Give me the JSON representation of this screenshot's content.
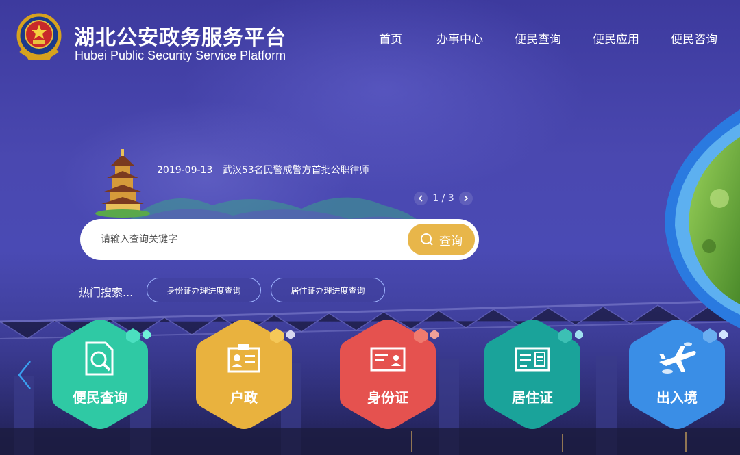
{
  "header": {
    "title": "湖北公安政务服务平台",
    "subtitle": "Hubei Public Security Service Platform"
  },
  "nav": [
    "首页",
    "办事中心",
    "便民查询",
    "便民应用",
    "便民咨询"
  ],
  "news": {
    "date": "2019-09-13",
    "headline": "武汉53名民警成警方首批公职律师",
    "page": "1 / 3"
  },
  "search": {
    "placeholder": "请输入查询关键字",
    "button_label": "查询"
  },
  "hot": {
    "label": "热门搜索...",
    "tags": [
      "身份证办理进度查询",
      "居住证办理进度查询"
    ]
  },
  "tiles": [
    {
      "label": "便民查询",
      "color": "#2fc9a4",
      "icon": "magnifier-document-icon"
    },
    {
      "label": "户政",
      "color": "#e9b23e",
      "icon": "household-card-icon"
    },
    {
      "label": "身份证",
      "color": "#e5524f",
      "icon": "id-card-icon"
    },
    {
      "label": "居住证",
      "color": "#1aa39a",
      "icon": "residence-card-icon"
    },
    {
      "label": "出入境",
      "color": "#3a8ee6",
      "icon": "airplane-icon"
    }
  ],
  "colors": {
    "background": "#4544ac",
    "accent": "#e8b64a"
  }
}
